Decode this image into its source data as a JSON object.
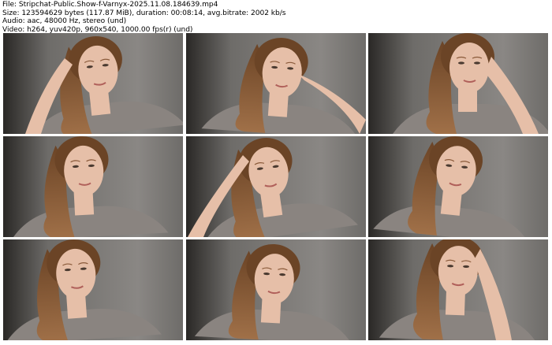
{
  "header": {
    "file_line": "File: Stripchat-Public.Show-f-Varnyx-2025.11.08.184639.mp4",
    "size_line": "Size: 123594629 bytes (117.87 MiB), duration: 00:08:14, avg.bitrate: 2002 kb/s",
    "audio_line": "Audio: aac, 48000 Hz, stereo (und)",
    "video_line": "Video: h264, yuv420p, 960x540, 1000.00 fps(r) (und)"
  },
  "thumbnails": [
    {
      "row": 1,
      "col": 1,
      "pose": "hand-on-head-left"
    },
    {
      "row": 1,
      "col": 2,
      "pose": "hand-on-cheek-right"
    },
    {
      "row": 1,
      "col": 3,
      "pose": "hand-on-face-right"
    },
    {
      "row": 2,
      "col": 1,
      "pose": "talking-left"
    },
    {
      "row": 2,
      "col": 2,
      "pose": "finger-on-temple"
    },
    {
      "row": 2,
      "col": 3,
      "pose": "looking-down"
    },
    {
      "row": 3,
      "col": 1,
      "pose": "looking-down-left"
    },
    {
      "row": 3,
      "col": 2,
      "pose": "looking-down-center"
    },
    {
      "row": 3,
      "col": 3,
      "pose": "hand-on-head-right"
    }
  ],
  "colors": {
    "wall": "#6e6c69",
    "wall_light": "#8a8784",
    "dark_left": "#2a2826",
    "hair": "#6b4426",
    "hair_light": "#a07048",
    "skin": "#e6bfa8",
    "shirt": "#8a8480"
  }
}
